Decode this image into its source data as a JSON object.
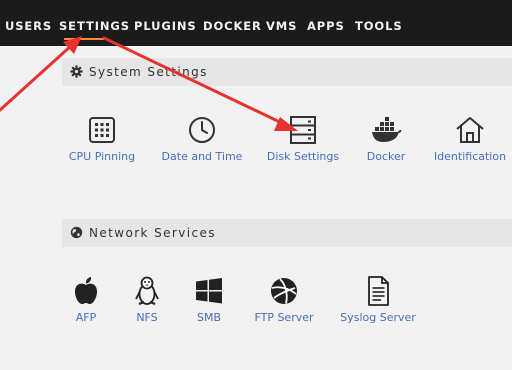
{
  "nav": {
    "items": [
      "USERS",
      "SETTINGS",
      "PLUGINS",
      "DOCKER",
      "VMS",
      "APPS",
      "TOOLS"
    ],
    "active": "SETTINGS"
  },
  "system_settings": {
    "title": "System Settings",
    "icon": "gear-icon",
    "tiles": [
      {
        "label": "CPU Pinning",
        "icon": "cpu-icon"
      },
      {
        "label": "Date and Time",
        "icon": "clock-icon"
      },
      {
        "label": "Disk Settings",
        "icon": "disk-icon"
      },
      {
        "label": "Docker",
        "icon": "docker-icon"
      },
      {
        "label": "Identification",
        "icon": "home-icon"
      }
    ]
  },
  "network_services": {
    "title": "Network Services",
    "icon": "globe-icon",
    "tiles": [
      {
        "label": "AFP",
        "icon": "apple-icon"
      },
      {
        "label": "NFS",
        "icon": "linux-icon"
      },
      {
        "label": "SMB",
        "icon": "windows-icon"
      },
      {
        "label": "FTP Server",
        "icon": "ftp-icon"
      },
      {
        "label": "Syslog Server",
        "icon": "document-icon"
      }
    ]
  },
  "colors": {
    "nav_bg": "#1c1b1b",
    "nav_text": "#f2f2f2",
    "active_underline": "#ff8c2f",
    "page_bg": "#f2f2f2",
    "section_bg": "#e6e6e6",
    "link": "#486dba",
    "annotation_arrow": "#e8322f"
  }
}
